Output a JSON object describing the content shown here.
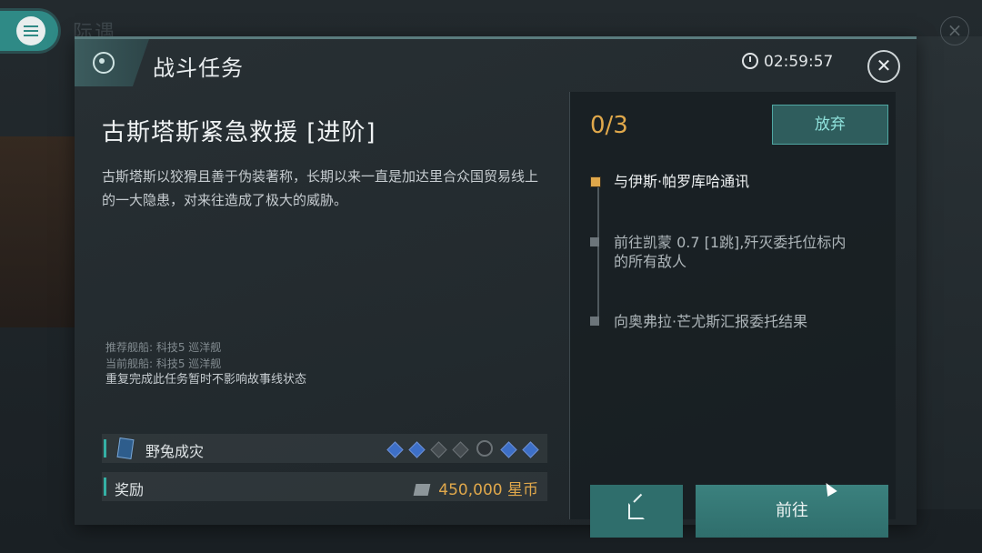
{
  "background": {
    "title_fragment": "际遇"
  },
  "dialog": {
    "header_title": "战斗任务",
    "timer": "02:59:57",
    "task_title": "古斯塔斯紧急救援 [进阶]",
    "description": "古斯塔斯以狡猾且善于伪装著称，长期以来一直是加达里合众国贸易线上的一大隐患，对来往造成了极大的威胁。",
    "notes": {
      "recommended_ship": "推荐舰船: 科技5 巡洋舰",
      "current_ship": "当前舰船: 科技5 巡洋舰",
      "repeat_note": "重复完成此任务暂时不影响故事线状态"
    },
    "card_row": {
      "label": "野兔成灾",
      "diamonds": [
        "on",
        "on",
        "off",
        "off",
        "core",
        "on",
        "on"
      ]
    },
    "reward_row": {
      "label": "奖励",
      "amount": "450,000",
      "currency": "星币"
    },
    "right_panel": {
      "progress": "0/3",
      "abandon_label": "放弃",
      "steps": [
        {
          "text": "与伊斯·帕罗库哈通讯",
          "active": true
        },
        {
          "text": "前往凯蒙 0.7 [1跳],歼灭委托位标内的所有敌人",
          "active": false
        },
        {
          "text": "向奥弗拉·芒尤斯汇报委托结果",
          "active": false
        }
      ],
      "go_label": "前往"
    }
  },
  "colors": {
    "accent_teal": "#2f6e6c",
    "progress_gold": "#e0a84b",
    "active_step": "#e0a84b"
  }
}
